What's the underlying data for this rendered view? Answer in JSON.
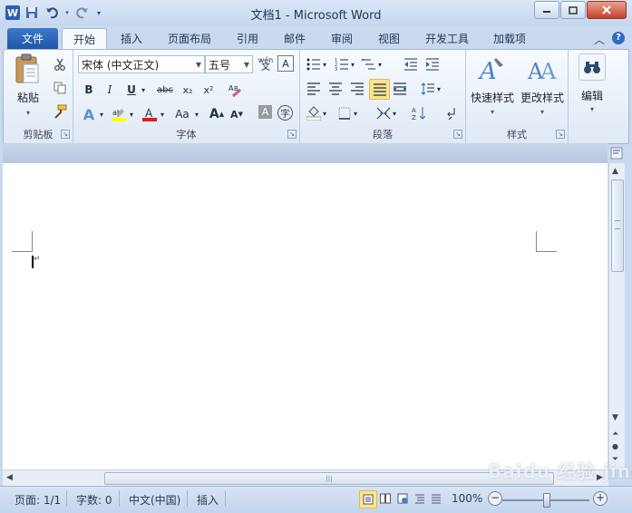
{
  "window": {
    "title": "文档1 - Microsoft Word",
    "app_icon": "word-logo",
    "controls": [
      "minimize",
      "maximize",
      "close"
    ]
  },
  "quick_access": {
    "save_icon": "save-icon",
    "undo_icon": "undo-icon",
    "redo_icon": "redo-icon"
  },
  "tabs": {
    "file": "文件",
    "items": [
      "开始",
      "插入",
      "页面布局",
      "引用",
      "邮件",
      "审阅",
      "视图",
      "开发工具",
      "加载项"
    ],
    "active": "开始"
  },
  "ribbon": {
    "clipboard": {
      "label": "剪贴板",
      "paste": "粘贴"
    },
    "font": {
      "label": "字体",
      "font_name": "宋体 (中文正文)",
      "font_size": "五号",
      "phonetic": "wén",
      "bold": "B",
      "italic": "I",
      "underline": "U",
      "strike": "abc",
      "subscript": "x₂",
      "superscript": "x²",
      "aa": "Aa",
      "grow": "A",
      "shrink": "A",
      "char_border": "A",
      "char_shade": "A",
      "enclose": "字"
    },
    "paragraph": {
      "label": "段落"
    },
    "styles": {
      "label": "样式",
      "quick_styles": "快速样式",
      "change_styles": "更改样式"
    },
    "editing": {
      "label": "编辑"
    }
  },
  "document": {
    "text": ""
  },
  "status_bar": {
    "page": "页面: 1/1",
    "words": "字数: 0",
    "language": "中文(中国)",
    "mode": "插入",
    "zoom": "100%",
    "zoom_percent": 100
  },
  "watermark": "Baidu 经验 jingyan.baidu.com"
}
